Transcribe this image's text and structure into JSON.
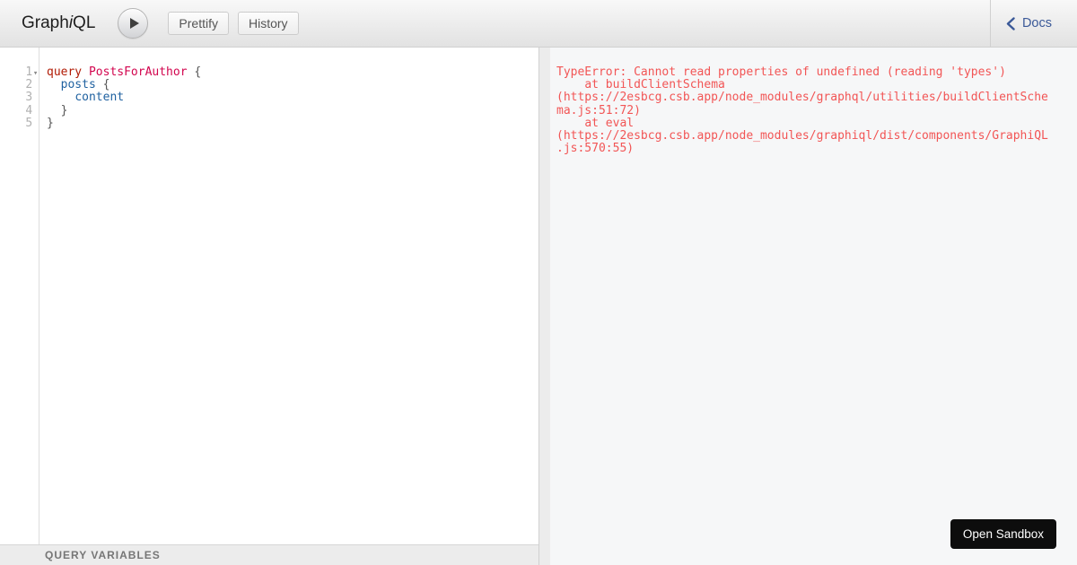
{
  "topbar": {
    "logo": {
      "part1": "Graph",
      "part2": "i",
      "part3": "QL"
    },
    "prettify_label": "Prettify",
    "history_label": "History",
    "docs_label": "Docs"
  },
  "icons": {
    "execute": "play-icon",
    "docs": "chevron-left-icon",
    "fold_open": "▾"
  },
  "editor": {
    "lines": [
      {
        "number": "1",
        "fold": "▾",
        "tokens": [
          {
            "t": "query",
            "c": "keyword"
          },
          {
            "t": " ",
            "c": "plain"
          },
          {
            "t": "PostsForAuthor",
            "c": "def"
          },
          {
            "t": " ",
            "c": "plain"
          },
          {
            "t": "{",
            "c": "punct"
          }
        ]
      },
      {
        "number": "2",
        "fold": "",
        "tokens": [
          {
            "t": "  ",
            "c": "plain"
          },
          {
            "t": "posts",
            "c": "property"
          },
          {
            "t": " ",
            "c": "plain"
          },
          {
            "t": "{",
            "c": "punct"
          }
        ]
      },
      {
        "number": "3",
        "fold": "",
        "tokens": [
          {
            "t": "    ",
            "c": "plain"
          },
          {
            "t": "content",
            "c": "property"
          }
        ]
      },
      {
        "number": "4",
        "fold": "",
        "tokens": [
          {
            "t": "  ",
            "c": "plain"
          },
          {
            "t": "}",
            "c": "punct"
          }
        ]
      },
      {
        "number": "5",
        "fold": "",
        "tokens": [
          {
            "t": "}",
            "c": "punct"
          }
        ]
      }
    ],
    "variables_title": "QUERY VARIABLES"
  },
  "result": {
    "error_text": "TypeError: Cannot read properties of undefined (reading 'types')\n    at buildClientSchema\n(https://2esbcg.csb.app/node_modules/graphql/utilities/buildClientSche\nma.js:51:72)\n    at eval\n(https://2esbcg.csb.app/node_modules/graphiql/dist/components/GraphiQL\n.js:570:55)"
  },
  "sandbox": {
    "label": "Open Sandbox"
  },
  "colors": {
    "topbar_gradient_top": "#f8f8f8",
    "topbar_gradient_bottom": "#e2e2e2",
    "topbar_border": "#d0d0d0",
    "docs_link": "#3B5998",
    "token_keyword": "#B11A04",
    "token_def": "#D2054E",
    "token_property": "#1F61A0",
    "token_punct": "#555555",
    "line_number": "#b0b0b0",
    "error_text": "#f25555",
    "result_bg": "#f6f7f8",
    "variables_bar_bg": "#ececec",
    "sandbox_button_bg": "#0d0d0d"
  }
}
